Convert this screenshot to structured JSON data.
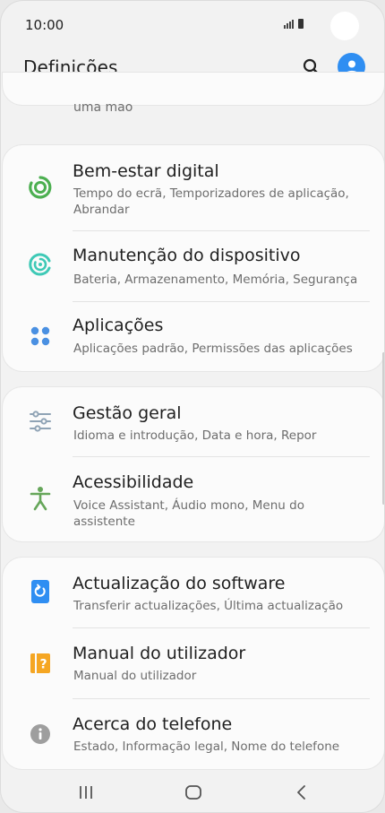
{
  "status": {
    "time": "10:00"
  },
  "header": {
    "title": "Definições"
  },
  "partial_item": {
    "subtitle": "uma mao"
  },
  "groups": [
    {
      "items": [
        {
          "title": "Bem-estar digital",
          "subtitle": "Tempo do ecrã, Temporizadores de aplicação, Abrandar",
          "icon": "digital-wellbeing-icon",
          "color": "#4caf50"
        },
        {
          "title": "Manutenção do dispositivo",
          "subtitle": "Bateria, Armazenamento, Memória, Segurança",
          "icon": "device-care-icon",
          "color": "#3ec9b6"
        },
        {
          "title": "Aplicações",
          "subtitle": "Aplicações padrão, Permissões das aplicações",
          "icon": "apps-icon",
          "color": "#4a90e2"
        }
      ]
    },
    {
      "items": [
        {
          "title": "Gestão geral",
          "subtitle": "Idioma e introdução, Data e hora, Repor",
          "icon": "sliders-icon",
          "color": "#8fa3b5"
        },
        {
          "title": "Acessibilidade",
          "subtitle": "Voice Assistant, Áudio mono, Menu do assistente",
          "icon": "accessibility-icon",
          "color": "#66a65a"
        }
      ]
    },
    {
      "items": [
        {
          "title": "Actualização do software",
          "subtitle": "Transferir actualizações, Última actualização",
          "icon": "software-update-icon",
          "color": "#2f8ef2"
        },
        {
          "title": "Manual do utilizador",
          "subtitle": "Manual do utilizador",
          "icon": "user-manual-icon",
          "color": "#f5a623"
        },
        {
          "title": "Acerca do telefone",
          "subtitle": "Estado, Informação legal, Nome do telefone",
          "icon": "info-icon",
          "color": "#9e9e9e"
        }
      ]
    }
  ],
  "nav": {
    "recents": "recents-icon",
    "home": "home-icon",
    "back": "back-icon"
  }
}
